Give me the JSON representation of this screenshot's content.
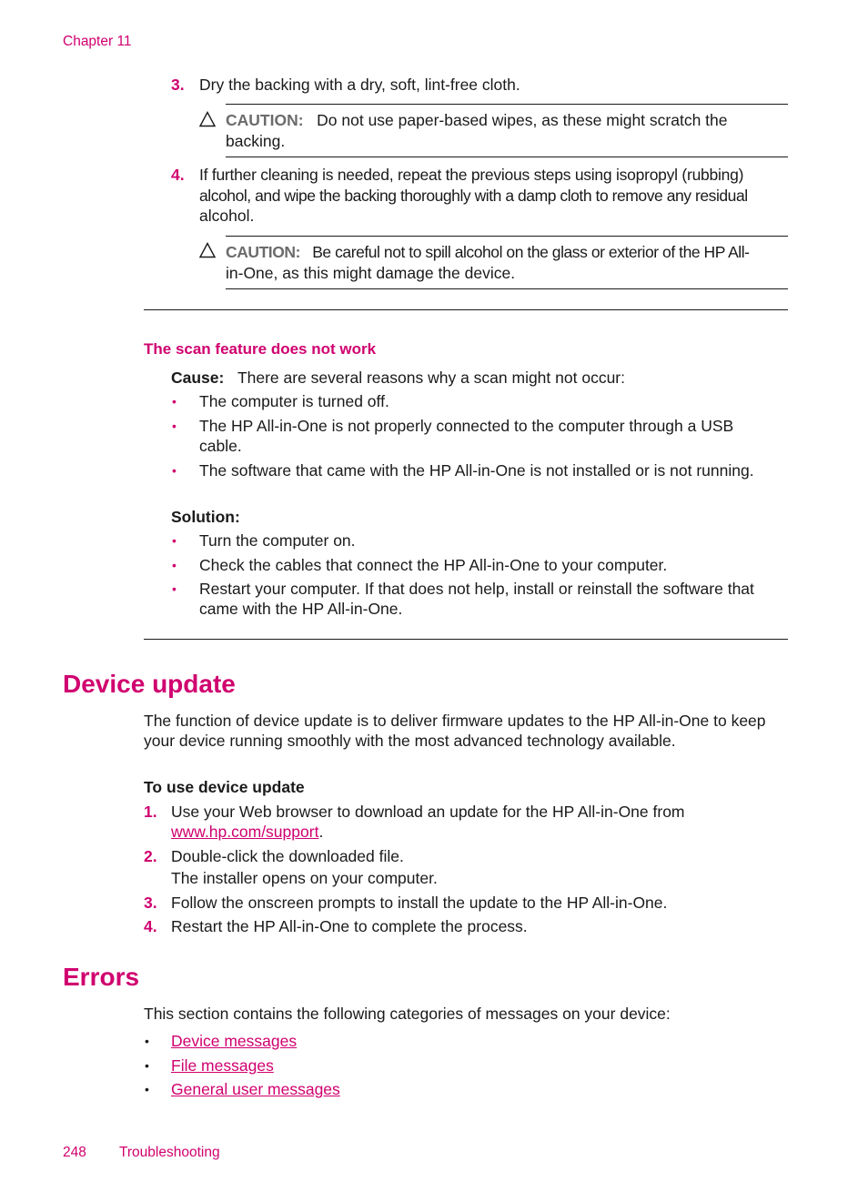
{
  "header": {
    "chapter": "Chapter 11"
  },
  "cleaning_steps": [
    {
      "number": "3.",
      "text": "Dry the backing with a dry, soft, lint-free cloth.",
      "caution": {
        "label": "CAUTION:",
        "line1": "Do not use paper-based wipes, as these might scratch the",
        "line2": "backing."
      }
    },
    {
      "number": "4.",
      "line1": "If further cleaning is needed, repeat the previous steps using isopropyl (rubbing)",
      "line2": "alcohol, and wipe the backing thoroughly with a damp cloth to remove any residual",
      "line3": "alcohol.",
      "caution": {
        "label": "CAUTION:",
        "line1": "Be careful not to spill alcohol on the glass or exterior of the HP All-",
        "line2": "in-One, as this might damage the device."
      }
    }
  ],
  "scan_section": {
    "title": "The scan feature does not work",
    "cause_label": "Cause:",
    "cause_text": "There are several reasons why a scan might not occur:",
    "causes": [
      {
        "line1": "The computer is turned off."
      },
      {
        "line1": "The HP All-in-One is not properly connected to the computer through a USB",
        "line2": "cable."
      },
      {
        "line1": "The software that came with the HP All-in-One is not installed or is not running."
      }
    ],
    "solution_label": "Solution:",
    "solutions": [
      {
        "line1": "Turn the computer on."
      },
      {
        "line1": "Check the cables that connect the HP All-in-One to your computer."
      },
      {
        "line1": "Restart your computer. If that does not help, install or reinstall the software that",
        "line2": "came with the HP All-in-One."
      }
    ]
  },
  "device_update": {
    "title": "Device update",
    "intro_line1": "The function of device update is to deliver firmware updates to the HP All-in-One to keep",
    "intro_line2": "your device running smoothly with the most advanced technology available.",
    "procedure_title": "To use device update",
    "steps": [
      {
        "number": "1.",
        "line1": "Use your Web browser to download an update for the HP All-in-One from",
        "link": "www.hp.com/support",
        "link_suffix": "."
      },
      {
        "number": "2.",
        "line1": "Double-click the downloaded file.",
        "line2": "The installer opens on your computer."
      },
      {
        "number": "3.",
        "line1": "Follow the onscreen prompts to install the update to the HP All-in-One."
      },
      {
        "number": "4.",
        "line1": "Restart the HP All-in-One to complete the process."
      }
    ]
  },
  "errors": {
    "title": "Errors",
    "intro": "This section contains the following categories of messages on your device:",
    "links": [
      "Device messages",
      "File messages",
      "General user messages"
    ]
  },
  "footer": {
    "page_number": "248",
    "section": "Troubleshooting"
  },
  "colors": {
    "accent": "#d0006f",
    "text": "#1a1a1a",
    "caution_label": "#6b6b6b"
  }
}
